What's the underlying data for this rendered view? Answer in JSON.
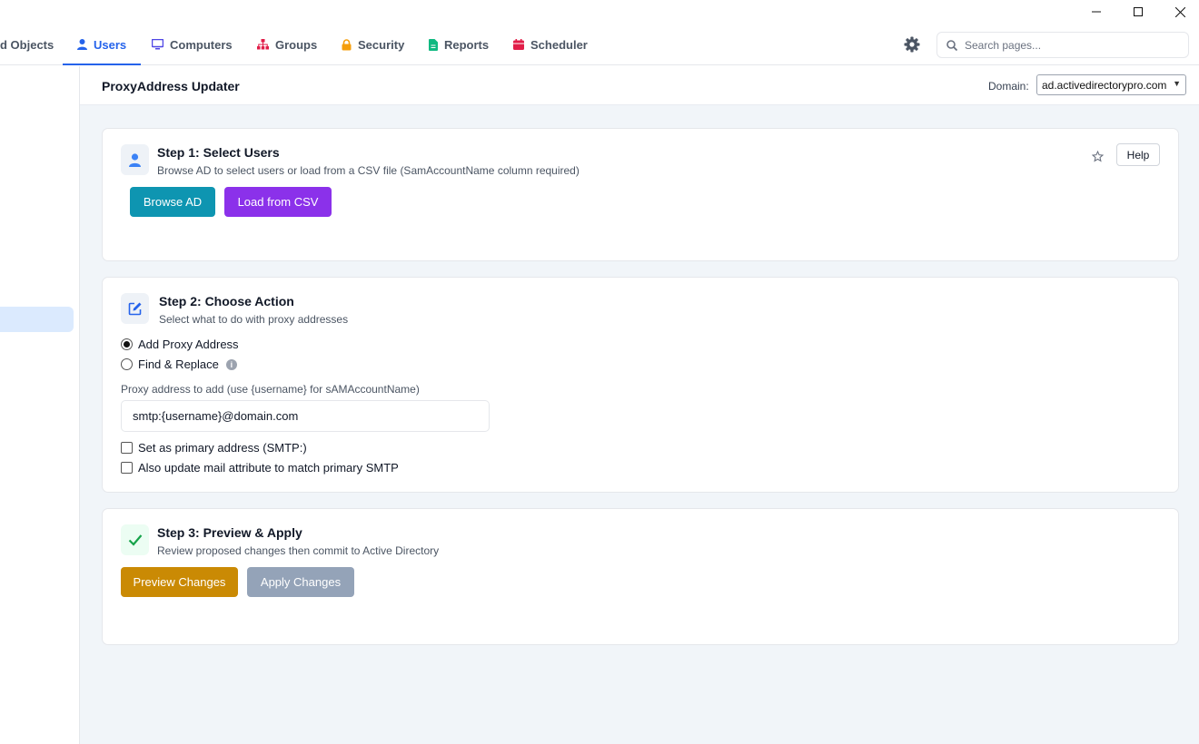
{
  "window": {
    "controls": {
      "minimize": "minimize-icon",
      "maximize": "maximize-icon",
      "close": "close-icon"
    }
  },
  "nav": {
    "tabs": [
      {
        "label": "d Objects",
        "icon": "objects-icon"
      },
      {
        "label": "Users",
        "icon": "user-icon",
        "active": true
      },
      {
        "label": "Computers",
        "icon": "monitor-icon"
      },
      {
        "label": "Groups",
        "icon": "sitemap-icon"
      },
      {
        "label": "Security",
        "icon": "lock-icon"
      },
      {
        "label": "Reports",
        "icon": "file-icon"
      },
      {
        "label": "Scheduler",
        "icon": "calendar-icon"
      }
    ],
    "settings_icon": "gear-icon",
    "search": {
      "placeholder": "Search pages...",
      "value": ""
    }
  },
  "header": {
    "title": "ProxyAddress Updater",
    "domain_label": "Domain:",
    "domain_value": "ad.activedirectorypro.com"
  },
  "step1": {
    "title": "Step 1: Select Users",
    "subtitle": "Browse AD to select users or load from a CSV file (SamAccountName column required)",
    "browse_label": "Browse AD",
    "csv_label": "Load from CSV",
    "help_label": "Help"
  },
  "step2": {
    "title": "Step 2: Choose Action",
    "subtitle": "Select what to do with proxy addresses",
    "options": [
      {
        "label": "Add Proxy Address",
        "checked": true
      },
      {
        "label": "Find & Replace",
        "checked": false
      }
    ],
    "field_label": "Proxy address to add (use {username} for sAMAccountName)",
    "field_value": "smtp:{username}@domain.com",
    "checkboxes": [
      {
        "label": "Set as primary address (SMTP:)",
        "checked": false
      },
      {
        "label": "Also update mail attribute to match primary SMTP",
        "checked": false
      }
    ]
  },
  "step3": {
    "title": "Step 3: Preview & Apply",
    "subtitle": "Review proposed changes then commit to Active Directory",
    "preview_label": "Preview Changes",
    "apply_label": "Apply Changes"
  },
  "colors": {
    "accent": "#2563eb",
    "browse": "#0e95b1",
    "csv": "#8b31ea",
    "preview": "#ca8a04",
    "apply_disabled": "#94a3b8"
  }
}
